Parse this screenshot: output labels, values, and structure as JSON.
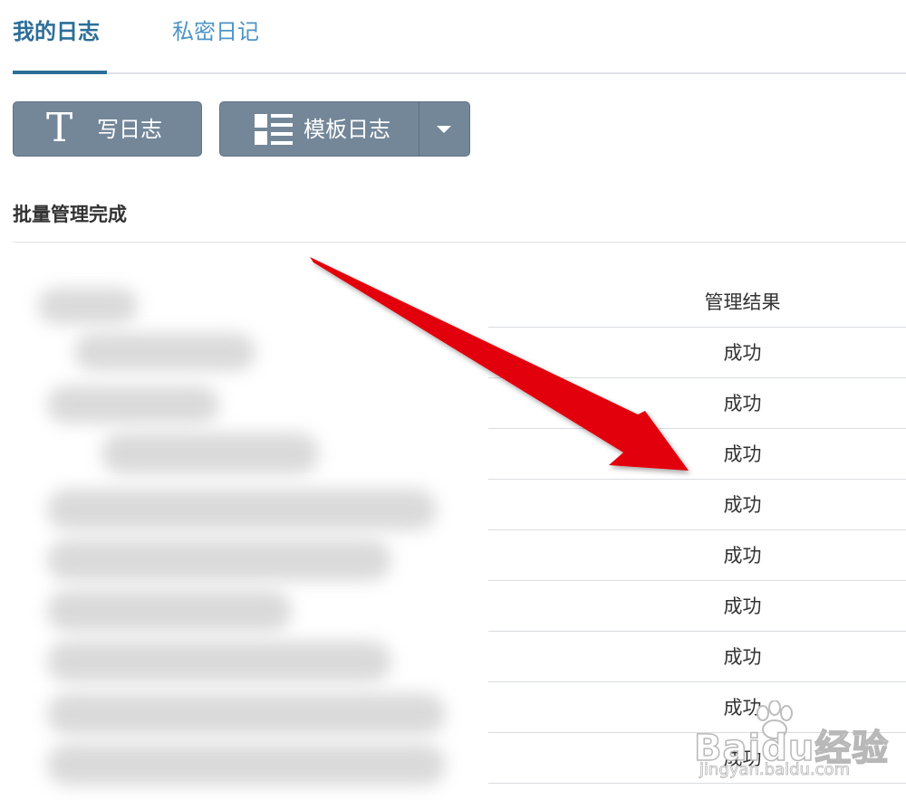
{
  "tabs": [
    {
      "label": "我的日志",
      "active": true
    },
    {
      "label": "私密日记",
      "active": false
    }
  ],
  "toolbar": {
    "write_label": "写日志",
    "template_label": "模板日志",
    "write_icon": "T-text-icon",
    "template_icon": "list-template-icon",
    "dropdown_icon": "caret-down-icon"
  },
  "section": {
    "title": "批量管理完成"
  },
  "results": {
    "header": "管理结果",
    "rows": [
      "成功",
      "成功",
      "成功",
      "成功",
      "成功",
      "成功",
      "成功",
      "成功",
      "成功"
    ]
  },
  "annotation": {
    "arrow_color": "#e3000b"
  },
  "watermark": {
    "logo": "Baidu经验",
    "url": "jingyan.baidu.com"
  },
  "colors": {
    "active_tab": "#2c6e98",
    "inactive_tab": "#4d94c6",
    "button_bg": "#738799"
  }
}
